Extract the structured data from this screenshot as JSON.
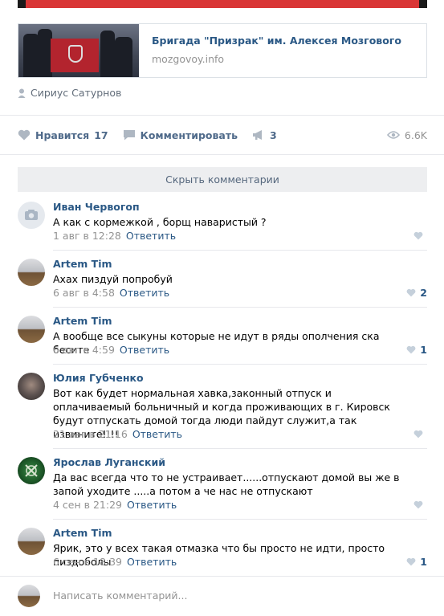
{
  "link": {
    "title": "Бригада \"Призрак\" им. Алексея Мозгового",
    "domain": "mozgovoy.info"
  },
  "author": {
    "name": "Сириус Сатурнов",
    "icon": "pin-icon"
  },
  "actions": {
    "like_label": "Нравится",
    "like_count": "17",
    "comment_label": "Комментировать",
    "share_count": "3",
    "views_count": "6.6K"
  },
  "hide_comments_label": "Скрыть комментарии",
  "comments": [
    {
      "name": "Иван Червогоп",
      "text": "А как с кормежкой , борщ наваристый ?",
      "date": "1 авг в 12:28",
      "reply": "Ответить",
      "likes": ""
    },
    {
      "name": "Artem Tim",
      "text": "Ахах пиздуй попробуй",
      "date": "6 авг в 4:58",
      "reply": "Ответить",
      "likes": "2"
    },
    {
      "name": "Artem Tim",
      "text": "А вообще все сыкуны которые не идут в ряды ополчения ска бесите",
      "date": "6 авг в 4:59",
      "reply": "Ответить",
      "likes": "1"
    },
    {
      "name": "Юлия Губченко",
      "text": "Вот как будет нормальная хавка,законный отпуск и оплачиваемый больничный и когда проживающих в г. Кировск будут отпускать домой тогда люди пайдут служит,а так извините!!!!",
      "date": "21 авг в 21:16",
      "reply": "Ответить",
      "likes": ""
    },
    {
      "name": "Ярослав Луганский",
      "text": "Да вас всегда что то не устраивает......отпускают домой вы же в запой уходите .....а потом а че нас не отпускают",
      "date": "4 сен в 21:29",
      "reply": "Ответить",
      "likes": ""
    },
    {
      "name": "Artem Tim",
      "text": "Ярик, это у всех такая отмазка что бы просто не идти, просто пиздоболы",
      "date": "6 сен в 18:39",
      "reply": "Ответить",
      "likes": "1"
    }
  ],
  "composer": {
    "placeholder": "Написать комментарий..."
  },
  "colors": {
    "link": "#2a5885",
    "muted": "#939393",
    "accent_red": "#d93636"
  }
}
